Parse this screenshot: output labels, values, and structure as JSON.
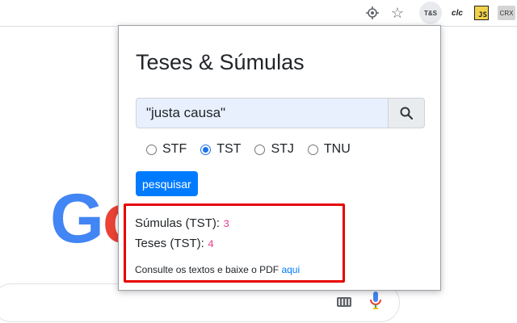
{
  "toolbar": {
    "extensions": [
      {
        "name": "locate-icon"
      },
      {
        "name": "star-icon"
      },
      {
        "name": "teses-sumulas-extension",
        "label": "T&S"
      },
      {
        "name": "clc-extension",
        "label": "clc"
      },
      {
        "name": "js-extension",
        "label": "JS"
      },
      {
        "name": "crx-extension",
        "label": "CRX"
      }
    ]
  },
  "popup": {
    "title": "Teses & Súmulas",
    "search": {
      "value": "\"justa causa\"",
      "icon": "search-icon"
    },
    "courts": [
      {
        "label": "STF",
        "checked": false
      },
      {
        "label": "TST",
        "checked": true
      },
      {
        "label": "STJ",
        "checked": false
      },
      {
        "label": "TNU",
        "checked": false
      }
    ],
    "submit_label": "pesquisar",
    "results": {
      "sumulas_label": "Súmulas (TST):",
      "sumulas_count": "3",
      "teses_label": "Teses (TST):",
      "teses_count": "4",
      "note_text": "Consulte os textos e baixe o PDF",
      "note_link": "aqui"
    },
    "highlight_color": "#e60000",
    "accent_color": "#007bff"
  },
  "background": {
    "logo_partial": [
      "G",
      "o"
    ]
  }
}
